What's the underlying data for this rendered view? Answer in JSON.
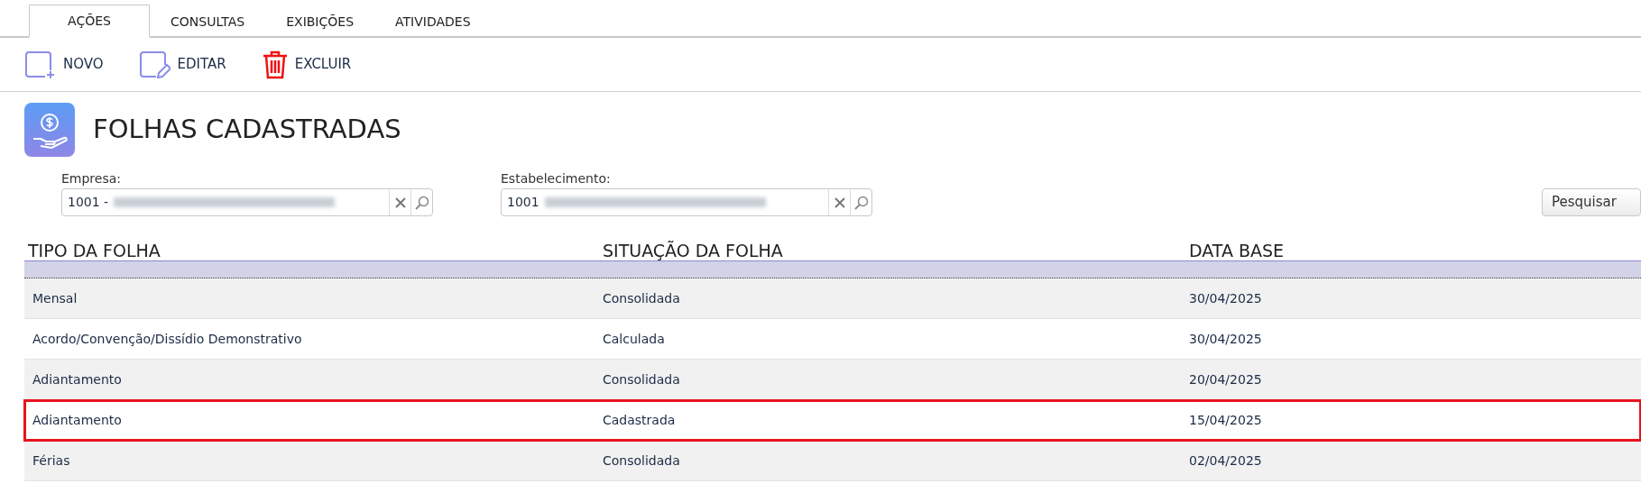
{
  "tabs": [
    {
      "label": "AÇÕES",
      "selected": true
    },
    {
      "label": "CONSULTAS",
      "selected": false
    },
    {
      "label": "EXIBIÇÕES",
      "selected": false
    },
    {
      "label": "ATIVIDADES",
      "selected": false
    }
  ],
  "toolbar": [
    {
      "kind": "new",
      "label": "NOVO"
    },
    {
      "kind": "edit",
      "label": "EDITAR"
    },
    {
      "kind": "delete",
      "label": "EXCLUIR"
    }
  ],
  "page_title": "FOLHAS CADASTRADAS",
  "filters": [
    {
      "label": "Empresa:",
      "value": "1001 -",
      "redacted": true
    },
    {
      "label": "Estabelecimento:",
      "value": "1001",
      "redacted": true
    }
  ],
  "search_button": "Pesquisar",
  "table": {
    "columns": [
      "TIPO DA FOLHA",
      "SITUAÇÃO DA FOLHA",
      "DATA BASE"
    ],
    "rows": [
      {
        "partial": true,
        "selected": true,
        "highlighted": false
      },
      {
        "cells": [
          "Mensal",
          "Consolidada",
          "30/04/2025"
        ],
        "selected": false,
        "highlighted": false
      },
      {
        "cells": [
          "Acordo/Convenção/Dissídio Demonstrativo",
          "Calculada",
          "30/04/2025"
        ],
        "selected": false,
        "highlighted": false
      },
      {
        "cells": [
          "Adiantamento",
          "Consolidada",
          "20/04/2025"
        ],
        "selected": false,
        "highlighted": false
      },
      {
        "cells": [
          "Adiantamento",
          "Cadastrada",
          "15/04/2025"
        ],
        "selected": false,
        "highlighted": true
      },
      {
        "cells": [
          "Férias",
          "Consolidada",
          "02/04/2025"
        ],
        "selected": false,
        "highlighted": false
      }
    ]
  }
}
